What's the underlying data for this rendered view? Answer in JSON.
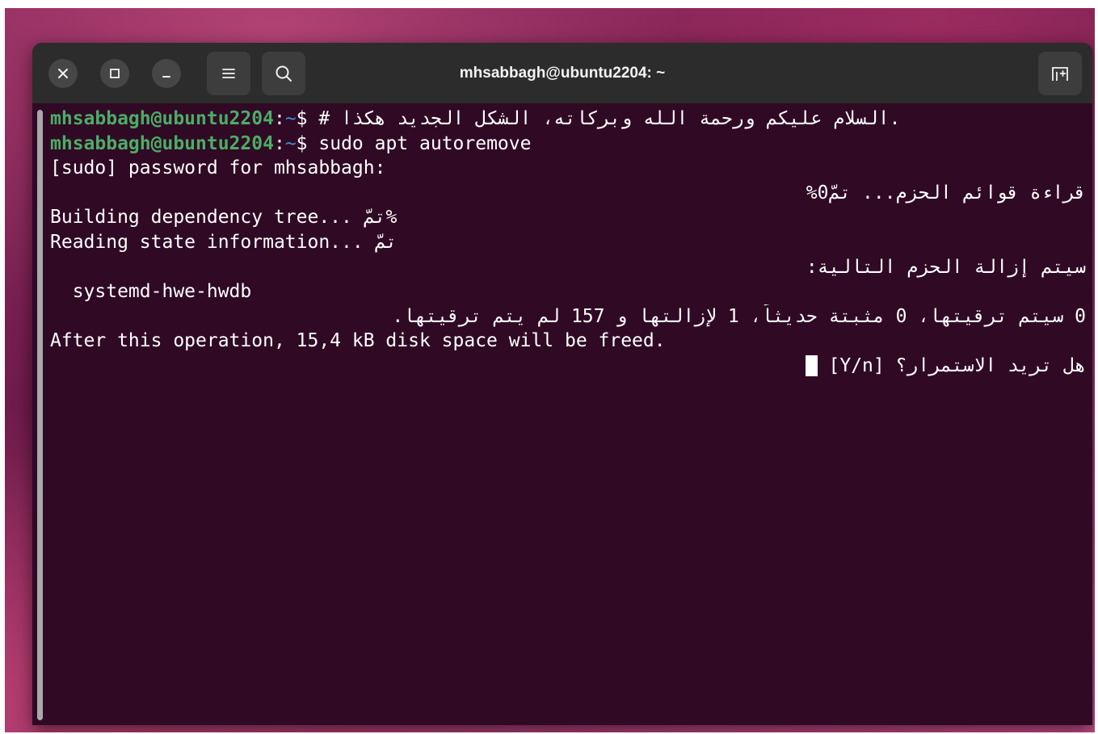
{
  "window": {
    "title": "mhsabbagh@ubuntu2204: ~"
  },
  "titlebar": {
    "close_icon": "close-icon",
    "maximize_icon": "maximize-icon",
    "minimize_icon": "minimize-icon",
    "menu_icon": "hamburger-menu-icon",
    "search_icon": "search-icon",
    "new_tab_icon": "new-tab-icon"
  },
  "terminal": {
    "prompt_user": "mhsabbagh@ubuntu2204",
    "prompt_sep": ":",
    "prompt_path": "~",
    "prompt_symbol": "$ ",
    "line1_cmd": "# السلام عليكم ورحمة الله وبركاته، الشكل الجديد هكذا.",
    "line2_cmd": "sudo apt autoremove",
    "line3": "[sudo] password for mhsabbagh:",
    "line4": "قراءة قوائم الحزم... تمّ0%",
    "line5": "Building dependency tree... تمّ%",
    "line6": "Reading state information... تمّ",
    "line7": "سيتم إزالة الحزم التالية:",
    "line8": "  systemd-hwe-hwdb",
    "line9": "0 سيتم ترقيتها، 0 مثبتة حديثاً، 1 لإزالتها و 157 لم يتم ترقيتها.",
    "line10": "After this operation, 15,4 kB disk space will be freed.",
    "line11": "هل تريد الاستمرار؟ [Y/n] "
  },
  "colors": {
    "terminal_bg": "#300a24",
    "titlebar_bg": "#2c2c2c",
    "prompt_user": "#4bad66",
    "prompt_path": "#3e8ede"
  }
}
